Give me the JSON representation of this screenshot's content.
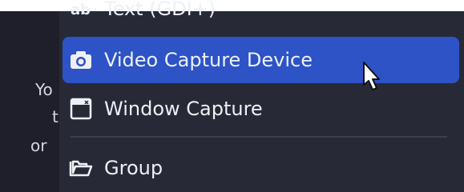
{
  "left_panel": {
    "line_1": "Yo",
    "line_2": "t",
    "line_3": "or"
  },
  "menu": {
    "items": [
      {
        "label": "Text (GDI+)",
        "icon": "text-icon"
      },
      {
        "label": "Video Capture Device",
        "icon": "camera-icon",
        "highlighted": true
      },
      {
        "label": "Window Capture",
        "icon": "window-icon"
      },
      {
        "label": "Group",
        "icon": "folder-icon"
      }
    ]
  },
  "colors": {
    "highlight": "#2d53c6",
    "menu_bg": "#272a36",
    "panel_bg": "#1e1f2a",
    "text": "#eef0f6"
  }
}
